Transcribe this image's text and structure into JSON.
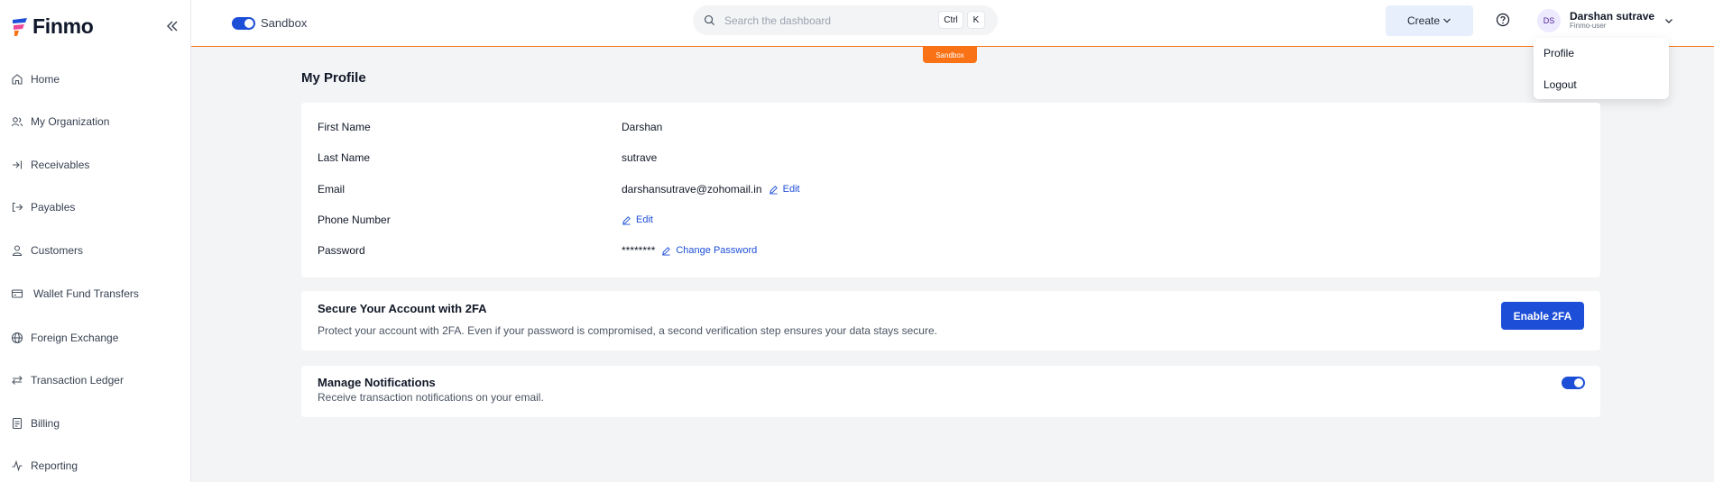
{
  "app": {
    "logo_text": "Finmo"
  },
  "sidebar": {
    "items": [
      {
        "label": "Home",
        "icon": "home-icon"
      },
      {
        "label": "My Organization",
        "icon": "users-icon"
      },
      {
        "label": "Receivables",
        "icon": "arrow-in-icon"
      },
      {
        "label": "Payables",
        "icon": "arrow-out-icon"
      },
      {
        "label": "Customers",
        "icon": "user-icon"
      },
      {
        "label": "Wallet Fund Transfers",
        "icon": "wallet-icon"
      },
      {
        "label": "Foreign Exchange",
        "icon": "globe-icon"
      },
      {
        "label": "Transaction Ledger",
        "icon": "exchange-icon"
      },
      {
        "label": "Billing",
        "icon": "document-icon"
      },
      {
        "label": "Reporting",
        "icon": "activity-icon"
      }
    ]
  },
  "header": {
    "sandbox_label": "Sandbox",
    "search_placeholder": "Search the dashboard",
    "kbd_ctrl": "Ctrl",
    "kbd_k": "K",
    "create_label": "Create",
    "user": {
      "initials": "DS",
      "name": "Darshan sutrave",
      "role": "Finmo-user"
    },
    "sandbox_badge": "Sandbox"
  },
  "user_menu": {
    "profile": "Profile",
    "logout": "Logout"
  },
  "profile": {
    "title": "My Profile",
    "first_name_label": "First Name",
    "first_name": "Darshan",
    "last_name_label": "Last Name",
    "last_name": "sutrave",
    "email_label": "Email",
    "email": "darshansutrave@zohomail.in",
    "phone_label": "Phone Number",
    "password_label": "Password",
    "password_mask": "********",
    "edit_label": "Edit",
    "change_password_label": "Change Password"
  },
  "twofa": {
    "title": "Secure Your Account with 2FA",
    "description": "Protect your account with 2FA. Even if your password is compromised, a second verification step ensures your data stays secure.",
    "button": "Enable 2FA"
  },
  "notifications": {
    "title": "Manage Notifications",
    "description": "Receive transaction notifications on your email.",
    "enabled": true
  },
  "colors": {
    "accent": "#1d4ed8",
    "sandbox": "#f97316"
  }
}
